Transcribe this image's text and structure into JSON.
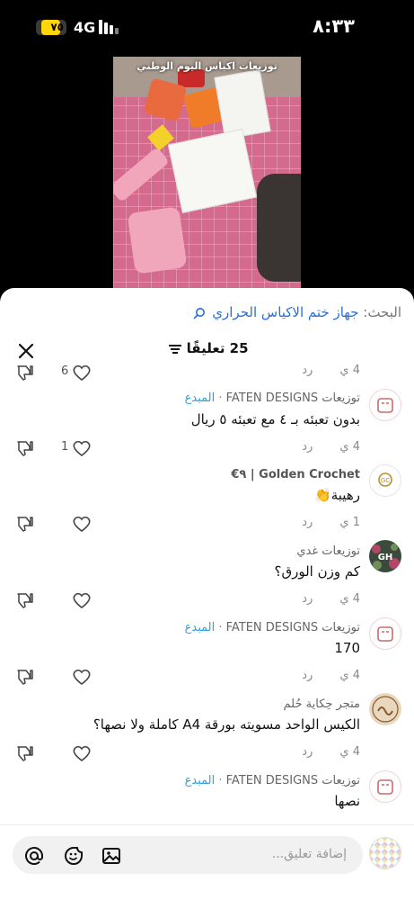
{
  "status_bar": {
    "battery": "٧٥",
    "battery_level": 0.75,
    "network": "4G",
    "time": "٨:٣٣"
  },
  "video": {
    "caption": "توزيعات اكياس اليوم الوطني"
  },
  "search": {
    "prefix": "البحث:",
    "term": "جهاز ختم الاكياس الحراري"
  },
  "header": {
    "count_label": "25 تعليقًا"
  },
  "comments": [
    {
      "meta_time": "4 ي",
      "reply": "رد",
      "likes": "6"
    },
    {
      "author": "توزيعات FATEN DESIGNS",
      "badge": "· المبدع",
      "text": "بدون تعبئه بـ ٤ مع تعبئه ٥ ريال",
      "meta_time": "4 ي",
      "reply": "رد",
      "likes": "1"
    },
    {
      "author": "Golden Crochet | ٩€",
      "text": "رهيبة👏",
      "meta_time": "1 ي",
      "reply": "رد",
      "likes": ""
    },
    {
      "author": "توزيعات غدي",
      "text": "كم وزن الورق؟",
      "meta_time": "4 ي",
      "reply": "رد",
      "likes": ""
    },
    {
      "author": "توزيعات FATEN DESIGNS",
      "badge": "· المبدع",
      "text": "170",
      "meta_time": "4 ي",
      "reply": "رد",
      "likes": ""
    },
    {
      "author": "متجر حِكاية حُلم",
      "text": "الكيس الواحد مسويته بورقة A4 كاملة ولا نصها؟",
      "meta_time": "4 ي",
      "reply": "رد",
      "likes": ""
    },
    {
      "author": "توزيعات FATEN DESIGNS",
      "badge": "· المبدع",
      "text": "نصها"
    }
  ],
  "composer": {
    "placeholder": "إضافة تعليق..."
  },
  "icons": {
    "close": "close-icon",
    "filter": "filter-icon",
    "search": "search-icon",
    "like": "heart-icon",
    "dislike": "thumbs-down-icon",
    "mention": "at-icon",
    "emoji": "emoji-icon",
    "image": "image-icon"
  },
  "colors": {
    "link": "#2a6fd6",
    "creator_badge": "#2fa0d8",
    "battery": "#ffd60a"
  }
}
